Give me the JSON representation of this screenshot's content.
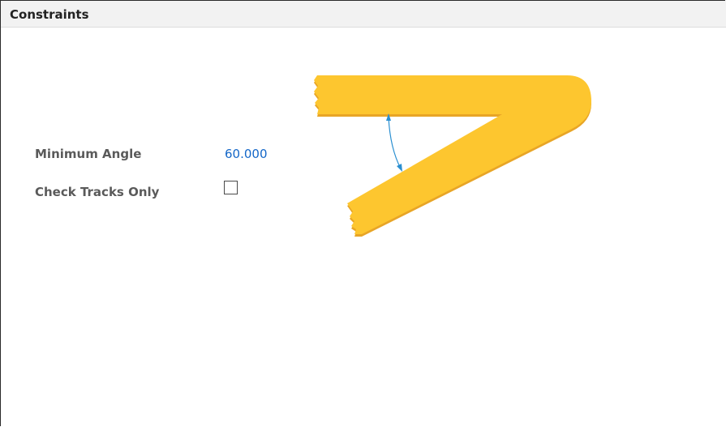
{
  "header": {
    "title": "Constraints"
  },
  "fields": {
    "min_angle": {
      "label": "Minimum Angle",
      "value": "60.000"
    },
    "check_tracks_only": {
      "label": "Check Tracks Only",
      "checked": false
    }
  },
  "diagram": {
    "track_color": "#fdc62f",
    "track_shadow_color": "#e8a526",
    "arrow_color": "#2a8fd1"
  },
  "colors": {
    "value_text": "#1467c8",
    "label_text": "#5a5a5a",
    "header_bg": "#f2f2f2"
  }
}
